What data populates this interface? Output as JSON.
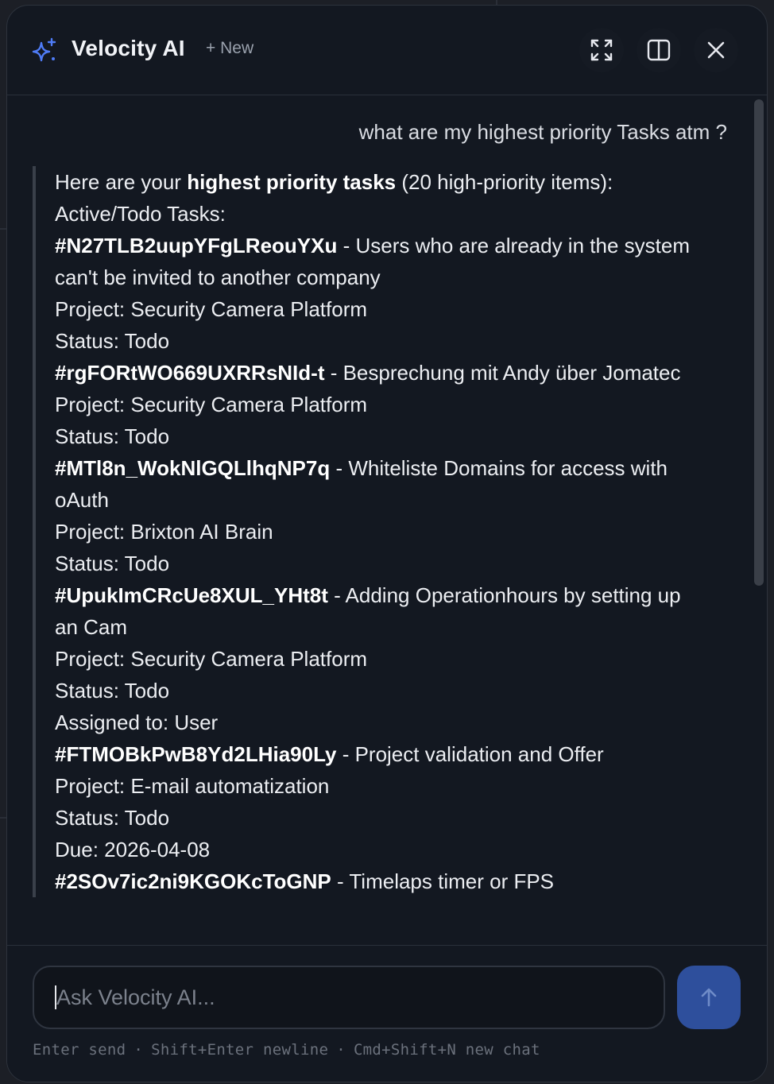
{
  "header": {
    "title": "Velocity AI",
    "new_label": "+ New"
  },
  "conversation": {
    "user_message": "what are my highest priority Tasks atm ?",
    "assistant": {
      "intro_prefix": "Here are your ",
      "intro_bold": "highest priority tasks",
      "intro_suffix": " (20 high-priority items):",
      "section_heading": "Active/Todo Tasks:",
      "tasks": [
        {
          "id": "#N27TLB2uupYFgLReouYXu",
          "title": " - Users who are already in the system can't be invited to another company",
          "details": [
            "Project: Security Camera Platform",
            "Status: Todo"
          ]
        },
        {
          "id": "#rgFORtWO669UXRRsNId-t",
          "title": " - Besprechung mit Andy über Jomatec",
          "details": [
            "Project: Security Camera Platform",
            "Status: Todo"
          ]
        },
        {
          "id": "#MTl8n_WokNlGQLlhqNP7q",
          "title": " - Whiteliste Domains for access with oAuth",
          "details": [
            "Project: Brixton AI Brain",
            "Status: Todo"
          ]
        },
        {
          "id": "#UpukImCRcUe8XUL_YHt8t",
          "title": " - Adding Operationhours by setting up an Cam",
          "details": [
            "Project: Security Camera Platform",
            "Status: Todo",
            "Assigned to: User"
          ]
        },
        {
          "id": "#FTMOBkPwB8Yd2LHia90Ly",
          "title": " - Project validation and Offer",
          "details": [
            "Project: E-mail automatization",
            "Status: Todo",
            "Due: 2026-04-08"
          ]
        },
        {
          "id": "#2SOv7ic2ni9KGOKcToGNP",
          "title": " - Timelaps timer or FPS",
          "details": []
        }
      ]
    }
  },
  "composer": {
    "placeholder": "Ask Velocity AI...",
    "hint_send": "Enter send",
    "hint_newline": "Shift+Enter newline",
    "hint_new_chat": "Cmd+Shift+N new chat",
    "separator": "·"
  },
  "colors": {
    "panel_bg": "#131821",
    "accent_icon": "#4f7cf7",
    "send_button": "#2e4f9c"
  },
  "icons": {
    "logo": "sparkle-icon",
    "expand": "expand-icon",
    "split": "split-view-icon",
    "close": "close-icon",
    "send": "arrow-up-icon"
  }
}
